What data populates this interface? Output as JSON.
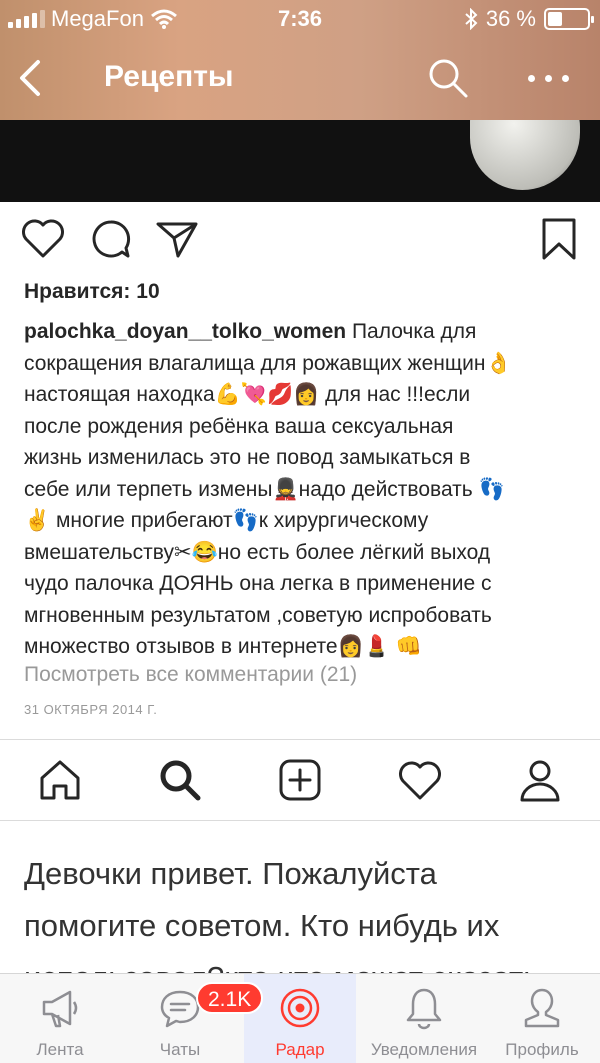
{
  "status_bar": {
    "carrier": "MegaFon",
    "time": "7:36",
    "battery_text": "36 %",
    "battery_level": 0.36
  },
  "nav": {
    "title": "Рецепты"
  },
  "post": {
    "likes": "Нравится: 10",
    "username": "palochka_doyan__tolko_women",
    "caption_lines": [
      " Палочка для",
      "сокращения влагалища для рожавщих женщин👌",
      "настоящая находка💪💘💋👩 для нас !!!если",
      "после рождения ребёнка ваша сексуальная",
      "жизнь изменилась это не повод замыкаться в",
      "себе или терпеть измены💂надо действовать 👣",
      "✌ многие прибегают👣к хирургическому",
      "вмешательству✂😂но есть более лёгкий выход",
      "чудо палочка ДОЯНЬ она легка в применение с",
      "мгновенным результатом ,советую испробовать",
      "множество отзывов в интернете👩💄 👊"
    ],
    "view_comments": "Посмотреть все комментарии (21)",
    "date": "31 ОКТЯБРЯ 2014 Г."
  },
  "message": {
    "text_lines": [
      "Девочки привет. Пожалуйста",
      "помогите советом. Кто нибудь их",
      "использовал?кто что может сказать"
    ]
  },
  "tab_bar": {
    "badge": "2.1K",
    "tabs": [
      {
        "label": "Лента",
        "icon": "megaphone-icon"
      },
      {
        "label": "Чаты",
        "icon": "chat-bubble-icon"
      },
      {
        "label": "Радар",
        "icon": "radar-icon"
      },
      {
        "label": "Уведомления",
        "icon": "bell-icon"
      },
      {
        "label": "Профиль",
        "icon": "profile-icon"
      }
    ]
  },
  "colors": {
    "accent": "#ff3b30",
    "active_tab_bg": "#e8ecfb",
    "muted_text": "#999999"
  }
}
